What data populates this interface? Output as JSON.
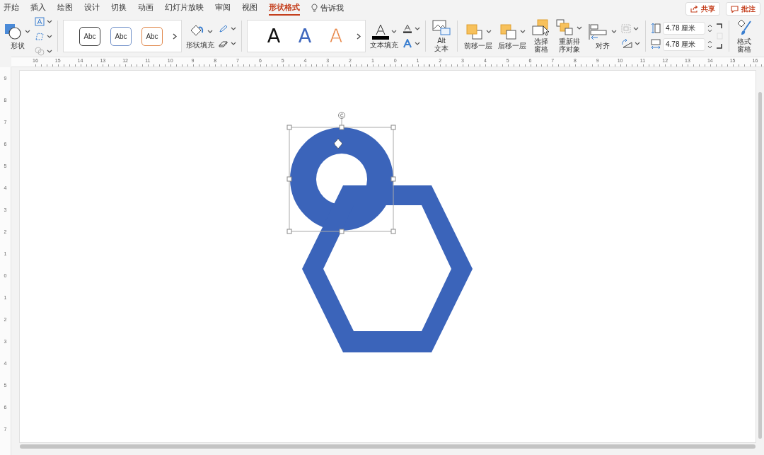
{
  "tabs": [
    {
      "label": "开始",
      "selected": false
    },
    {
      "label": "插入",
      "selected": false
    },
    {
      "label": "绘图",
      "selected": false
    },
    {
      "label": "设计",
      "selected": false
    },
    {
      "label": "切换",
      "selected": false
    },
    {
      "label": "动画",
      "selected": false
    },
    {
      "label": "幻灯片放映",
      "selected": false
    },
    {
      "label": "审阅",
      "selected": false
    },
    {
      "label": "视图",
      "selected": false
    },
    {
      "label": "形状格式",
      "selected": true
    }
  ],
  "tell_me": {
    "label": "告诉我"
  },
  "header_buttons": [
    {
      "label": "共享",
      "kind": "share"
    },
    {
      "label": "批注",
      "kind": "comment"
    }
  ],
  "ribbon": {
    "shape": {
      "label": "形状"
    },
    "shape_styles": [
      {
        "label": "Abc",
        "color": "#3a3a3a"
      },
      {
        "label": "Abc",
        "color": "#6f8fc8"
      },
      {
        "label": "Abc",
        "color": "#e0874a"
      }
    ],
    "shape_fill": {
      "label": "形状填充"
    },
    "wordart_styles": [
      {
        "label": "A",
        "color": "#111111",
        "kind": "solid"
      },
      {
        "label": "A",
        "color": "#3f67bd",
        "kind": "solid"
      },
      {
        "label": "A",
        "color": "#e8884a",
        "kind": "outline"
      }
    ],
    "text_fill": {
      "label": "文本填充"
    },
    "alt_text": {
      "lines": [
        "Alt",
        "文本"
      ]
    },
    "arrange": [
      {
        "lines": [
          "前移一层"
        ],
        "kind": "forward"
      },
      {
        "lines": [
          "后移一层"
        ],
        "kind": "backward"
      },
      {
        "lines": [
          "选择",
          "窗格"
        ],
        "kind": "pane"
      },
      {
        "lines": [
          "重新排",
          "序对象"
        ],
        "kind": "reorder"
      },
      {
        "lines": [
          "对齐"
        ],
        "kind": "align"
      }
    ],
    "height": {
      "value": "4.78 厘米"
    },
    "width": {
      "value": "4.78 厘米"
    },
    "format_pane": {
      "lines": [
        "格式",
        "窗格"
      ]
    }
  },
  "ruler": {
    "horizontal": [
      "16",
      "15",
      "14",
      "13",
      "12",
      "11",
      "10",
      "9",
      "8",
      "7",
      "6",
      "5",
      "4",
      "3",
      "2",
      "1",
      "0",
      "1",
      "2",
      "3",
      "4",
      "5",
      "6",
      "7",
      "8",
      "9",
      "10",
      "11",
      "12",
      "13",
      "14",
      "15",
      "16"
    ],
    "vertical": [
      "9",
      "8",
      "7",
      "6",
      "5",
      "4",
      "3",
      "2",
      "1",
      "0",
      "1",
      "2",
      "3",
      "4",
      "5",
      "6",
      "7"
    ]
  }
}
